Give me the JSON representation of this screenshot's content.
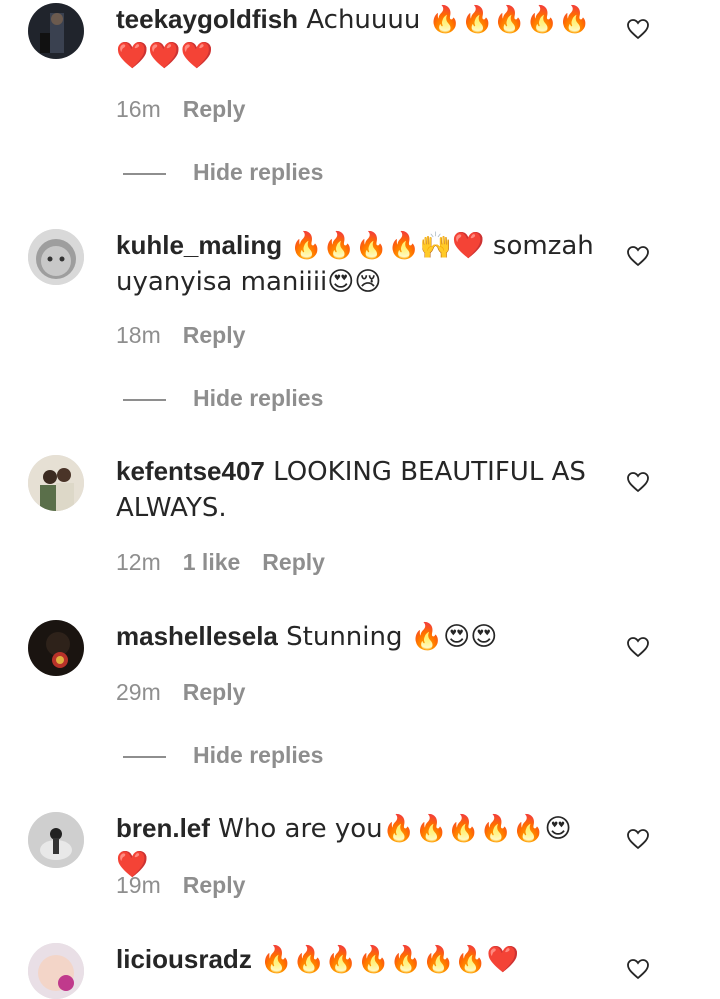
{
  "comments": [
    {
      "username": "teekaygoldfish",
      "text": " Achuuuu 🔥🔥🔥🔥🔥❤️❤️❤️",
      "time": "16m",
      "likes": "",
      "reply": "Reply",
      "hide_replies": "Hide replies"
    },
    {
      "username": "kuhle_maling",
      "text": " 🔥🔥🔥🔥🙌❤️ somzah uyanyisa maniiii😍😢",
      "time": "18m",
      "likes": "",
      "reply": "Reply",
      "hide_replies": "Hide replies"
    },
    {
      "username": "kefentse407",
      "text": " LOOKING BEAUTIFUL AS ALWAYS.",
      "time": "12m",
      "likes": "1 like",
      "reply": "Reply",
      "hide_replies": ""
    },
    {
      "username": "mashellesela",
      "text": " Stunning 🔥😍😍",
      "time": "29m",
      "likes": "",
      "reply": "Reply",
      "hide_replies": "Hide replies"
    },
    {
      "username": "bren.lef",
      "text": " Who are you🔥🔥🔥🔥🔥😍❤️",
      "time": "19m",
      "likes": "",
      "reply": "Reply",
      "hide_replies": ""
    },
    {
      "username": "liciousradz",
      "text": " 🔥🔥🔥🔥🔥🔥🔥❤️",
      "time": "",
      "likes": "",
      "reply": "",
      "hide_replies": ""
    }
  ],
  "icons": {
    "like": "heart-outline-icon"
  },
  "colors": {
    "text": "#262626",
    "muted": "#8e8e8e"
  }
}
